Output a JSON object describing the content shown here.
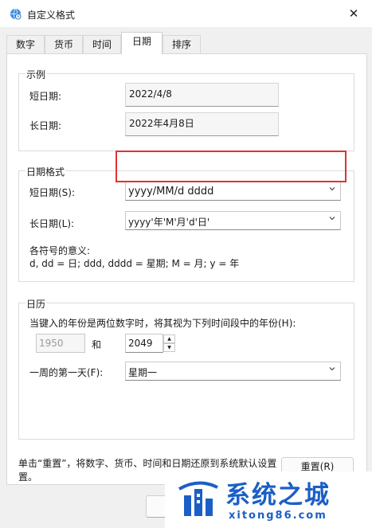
{
  "window": {
    "title": "自定义格式"
  },
  "tabs": [
    {
      "label": "数字"
    },
    {
      "label": "货币"
    },
    {
      "label": "时间"
    },
    {
      "label": "日期"
    },
    {
      "label": "排序"
    }
  ],
  "example": {
    "legend": "示例",
    "short_label": "短日期:",
    "short_value": "2022/4/8",
    "long_label": "长日期:",
    "long_value": "2022年4月8日"
  },
  "date_format": {
    "legend": "日期格式",
    "short_label": "短日期(S):",
    "short_value": "yyyy/MM/d dddd",
    "long_label": "长日期(L):",
    "long_value": "yyyy'年'M'月'd'日'",
    "meaning_title": "各符号的意义:",
    "meaning_text": "d, dd = 日;  ddd, dddd = 星期;  M = 月;  y = 年"
  },
  "calendar": {
    "legend": "日历",
    "two_digit_text": "当键入的年份是两位数字时，将其视为下列时间段中的年份(H):",
    "from_year": "1950",
    "and_label": "和",
    "to_year": "2049",
    "first_day_label": "一周的第一天(F):",
    "first_day_value": "星期一"
  },
  "footer": {
    "reset_text_line1": "单击“重置”，将数字、货币、时间和日期还原到系统默认设置",
    "reset_text_line2": "置。",
    "reset_button": "重置(R)"
  },
  "watermark": {
    "brand": "系统之城",
    "url": "xitong86.com"
  },
  "colors": {
    "highlight": "#e03232",
    "brand": "#1b5fc6"
  }
}
